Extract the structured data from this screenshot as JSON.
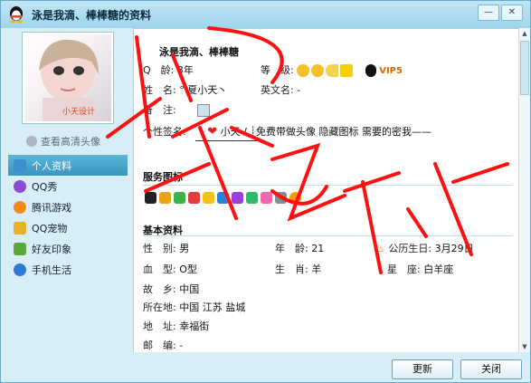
{
  "window": {
    "title": "泳是我滴、棒棒糖的资料"
  },
  "sidebar": {
    "avatar_caption": "小天设计",
    "hd_link": "查看高清头像",
    "items": [
      {
        "label": "个人资料",
        "active": true,
        "icon": "profile-card-icon",
        "color": "#3c8fd0"
      },
      {
        "label": "QQ秀",
        "active": false,
        "icon": "qq-show-icon",
        "color": "#8a4bd6"
      },
      {
        "label": "腾讯游戏",
        "active": false,
        "icon": "tencent-games-icon",
        "color": "#f08a1b"
      },
      {
        "label": "QQ宠物",
        "active": false,
        "icon": "qq-pet-icon",
        "color": "#e6b125"
      },
      {
        "label": "好友印象",
        "active": false,
        "icon": "friend-impression-icon",
        "color": "#5aa83a"
      },
      {
        "label": "手机生活",
        "active": false,
        "icon": "mobile-life-icon",
        "color": "#2a7bd1"
      }
    ]
  },
  "profile": {
    "name": "泳是我滴、棒棒糖",
    "qage_label": "Q　龄:",
    "qage": "3年",
    "level_label": "等　级:",
    "vip": "VIP5",
    "nick_label": "姓　名:",
    "nick": "°  夏小天丶",
    "eng_label": "英文名:",
    "eng": "-",
    "note_label": "备　注:",
    "sign_label": "个性签名:",
    "signature": "小天  /  ┊免费带做头像 隐藏图标  需要的密我——"
  },
  "services": {
    "title": "服务图标"
  },
  "basic": {
    "title": "基本资料",
    "gender_label": "性　别:",
    "gender": "男",
    "age_label": "年　龄:",
    "age": "21",
    "birthday_label": "公历生日:",
    "birthday": "3月29日",
    "blood_label": "血　型:",
    "blood": "O型",
    "zodiac_label": "生　肖:",
    "zodiac": "羊",
    "star_label": "星　座:",
    "star": "白羊座",
    "hometown_label": "故　乡:",
    "hometown": "中国",
    "location_label": "所在地:",
    "location": "中国 江苏 盐城",
    "address_label": "地　址:",
    "address": "幸福街",
    "zip_label": "邮　编:",
    "zip": "-"
  },
  "footer": {
    "refresh": "更新",
    "close": "关闭"
  },
  "watermark": {
    "text": "小天设计"
  }
}
